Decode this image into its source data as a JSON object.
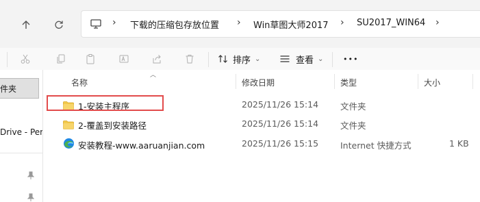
{
  "breadcrumb": {
    "items": [
      "下载的压缩包存放位置",
      "Win草图大师2017",
      "SU2017_WIN64"
    ]
  },
  "toolbar": {
    "sort_label": "排序",
    "view_label": "查看",
    "more_label": "•••"
  },
  "left_pane": {
    "selected_item": "件夹",
    "onedrive_item": "Drive - Per"
  },
  "columns": {
    "name": "名称",
    "date": "修改日期",
    "type": "类型",
    "size": "大小"
  },
  "files": [
    {
      "name": "1-安装主程序",
      "date": "2025/11/26 15:14",
      "type": "文件夹",
      "size": "",
      "icon": "folder-icon"
    },
    {
      "name": "2-覆盖到安装路径",
      "date": "2025/11/26 15:14",
      "type": "文件夹",
      "size": "",
      "icon": "folder-icon"
    },
    {
      "name": "安装教程-www.aaruanjian.com",
      "date": "2025/11/26 15:15",
      "type": "Internet 快捷方式",
      "size": "1 KB",
      "icon": "edge-icon"
    }
  ],
  "colors": {
    "highlight_border": "#e24b4b",
    "folder": "#f2c94c",
    "accent": "#0078d4"
  }
}
